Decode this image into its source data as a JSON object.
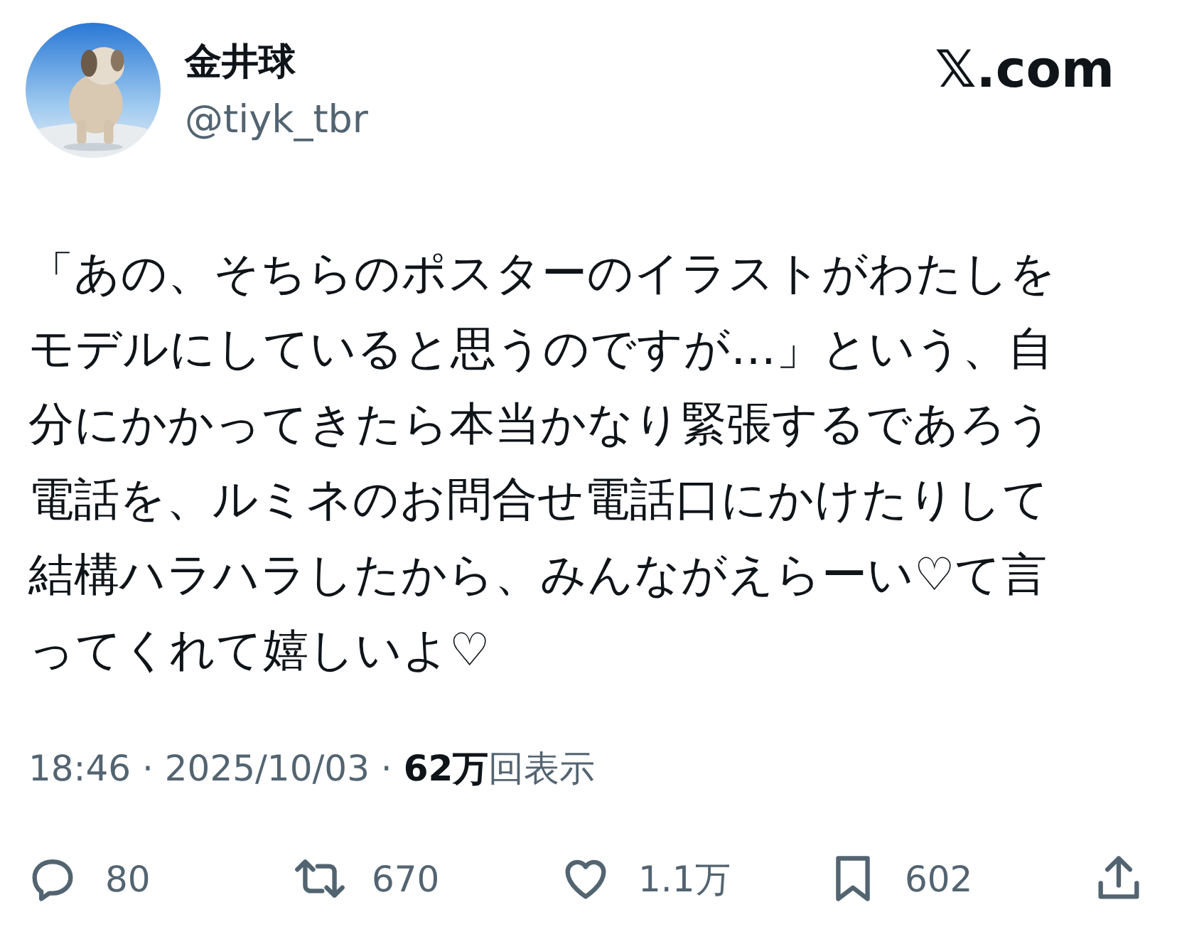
{
  "author": {
    "name": "金井球",
    "handle": "@tiyk_tbr"
  },
  "site": "𝕏.com",
  "text": "「あの、そちらのポスターのイラストがわたしをモデルにしていると思うのですが…」という、自分にかかってきたら本当かなり緊張するであろう電話を、ルミネのお問合せ電話口にかけたりして結構ハラハラしたから、みんながえらーい♡て言ってくれて嬉しいよ♡",
  "meta": "18:46 · 2025/10/03 · **62万**回表示",
  "actions": [
    {
      "kind": "reply",
      "count": "80"
    },
    {
      "kind": "repost",
      "count": "670"
    },
    {
      "kind": "like",
      "count": "1.1万"
    },
    {
      "kind": "bookmark",
      "count": "602"
    },
    {
      "kind": "share"
    }
  ]
}
